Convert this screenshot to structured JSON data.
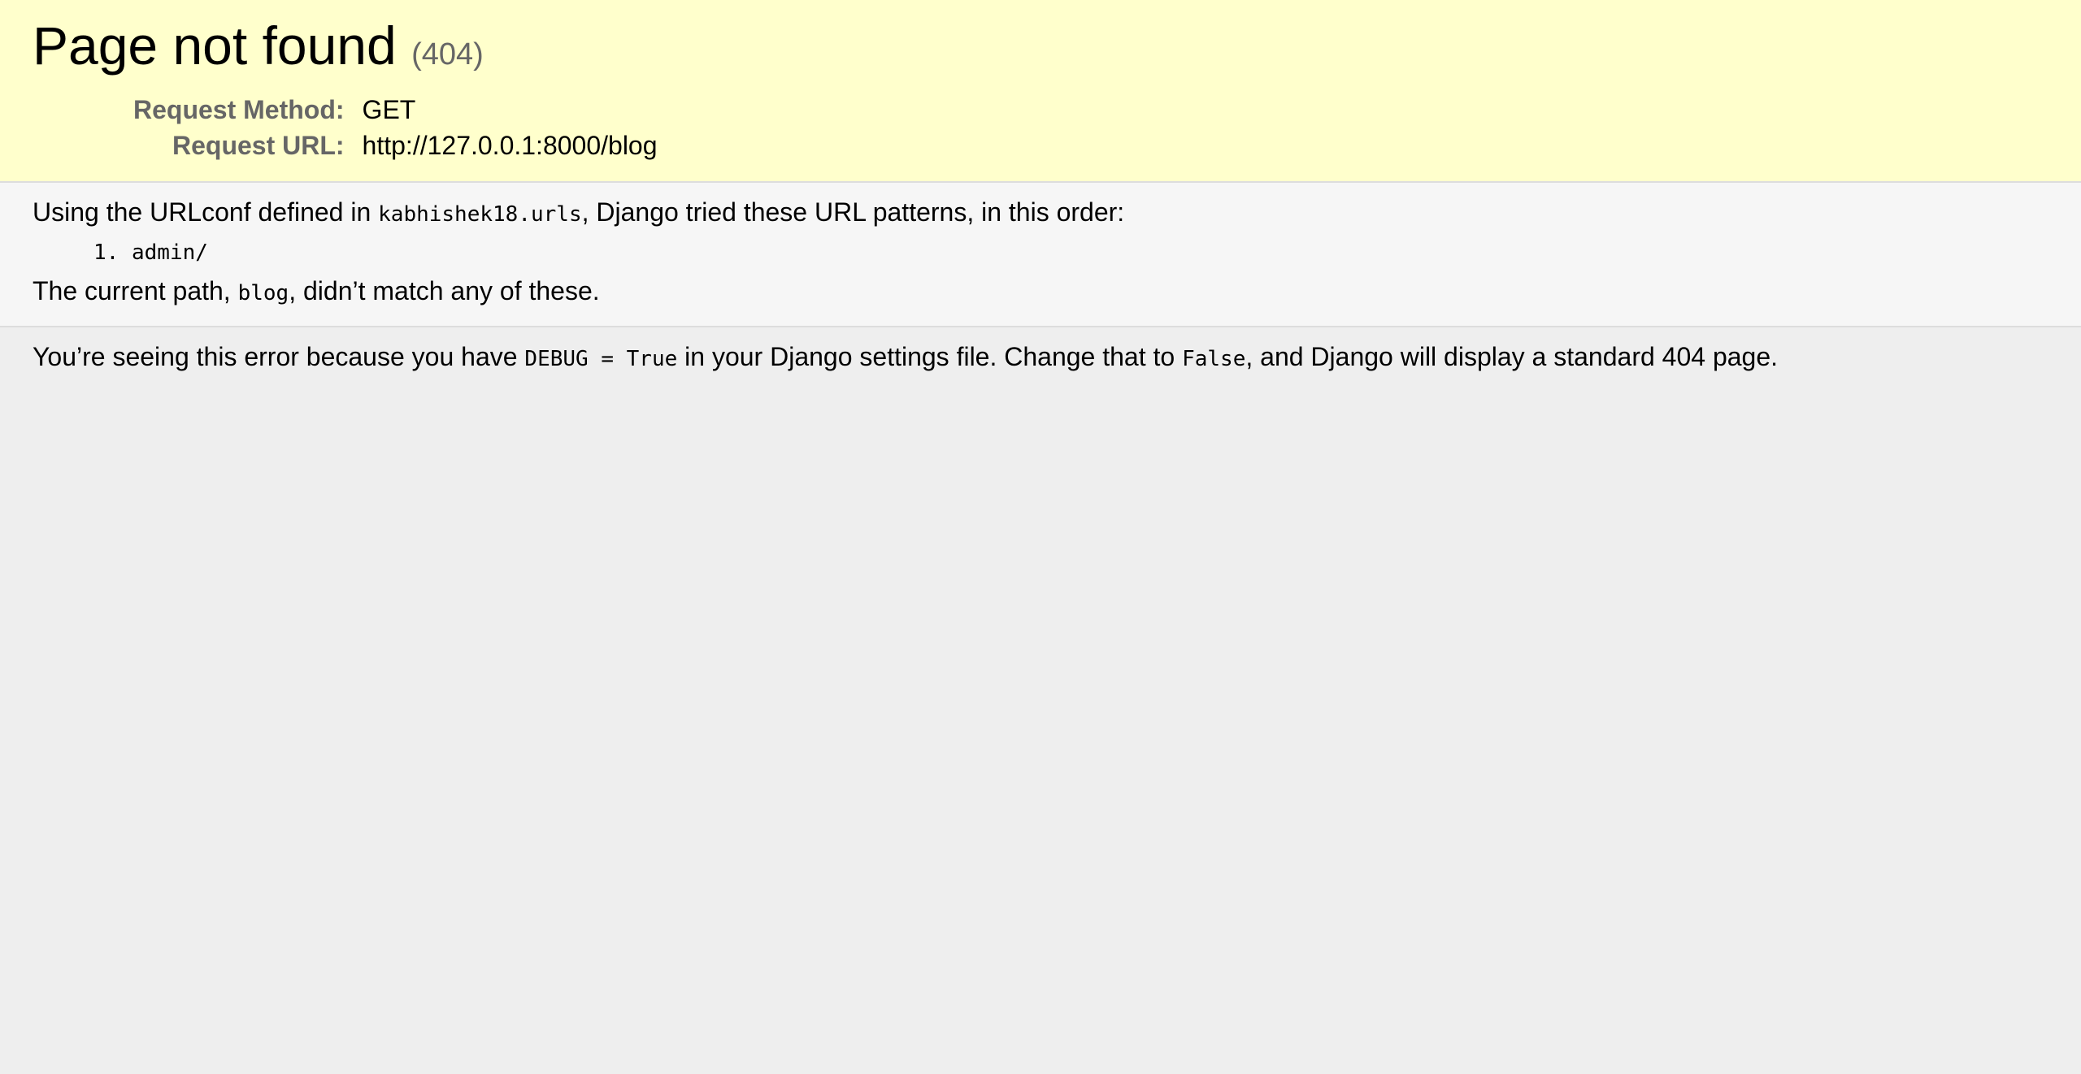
{
  "summary": {
    "title": "Page not found",
    "status_code": "(404)",
    "request_method_label": "Request Method:",
    "request_method_value": "GET",
    "request_url_label": "Request URL:",
    "request_url_value": "http://127.0.0.1:8000/blog"
  },
  "info": {
    "intro_prefix": "Using the URLconf defined in ",
    "urlconf": "kabhishek18.urls",
    "intro_suffix": ", Django tried these URL patterns, in this order:",
    "patterns": [
      "admin/"
    ],
    "current_path_prefix": "The current path, ",
    "current_path": "blog",
    "current_path_suffix": ", didn’t match any of these."
  },
  "explanation": {
    "part1": "You’re seeing this error because you have ",
    "debug_setting": "DEBUG = True",
    "part2": " in your Django settings file. Change that to ",
    "false_value": "False",
    "part3": ", and Django will display a standard 404 page."
  }
}
